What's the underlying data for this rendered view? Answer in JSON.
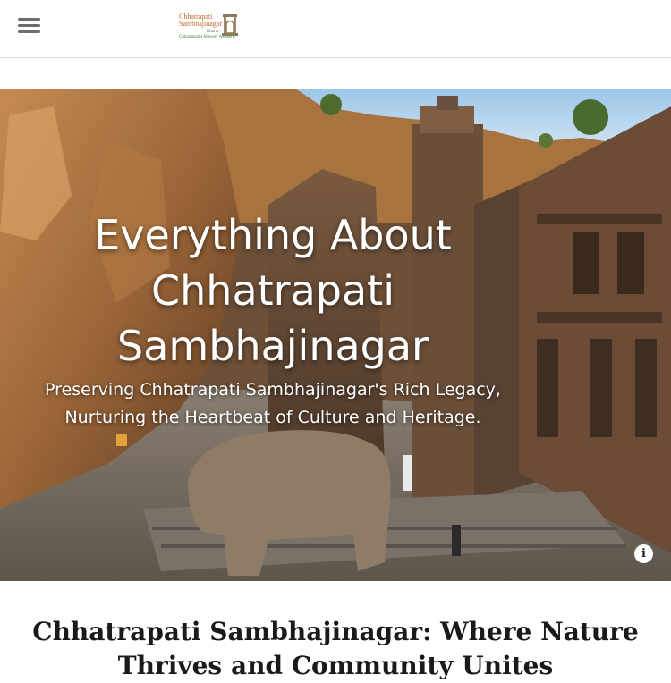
{
  "header": {
    "menu_icon": "hamburger-menu-icon",
    "logo": {
      "line1": "Chhatrapati",
      "line2": "Sambhajinagar",
      "line3": "Bharat",
      "line4": "Chhatrapati's Majesty Awakens",
      "icon": "temple-arch-icon"
    }
  },
  "hero": {
    "title": "Everything About Chhatrapati Sambhajinagar",
    "subtitle": "Preserving Chhatrapati Sambhajinagar's Rich Legacy, Nurturing the Heartbeat of Culture and Heritage.",
    "info_icon": "info-icon",
    "info_label": "i"
  },
  "section": {
    "heading": "Chhatrapati Sambhajinagar: Where Nature Thrives and Community Unites"
  },
  "colors": {
    "logo_orange": "#c9682a",
    "logo_green": "#3f8a3a",
    "header_border": "#dcdcdc"
  }
}
